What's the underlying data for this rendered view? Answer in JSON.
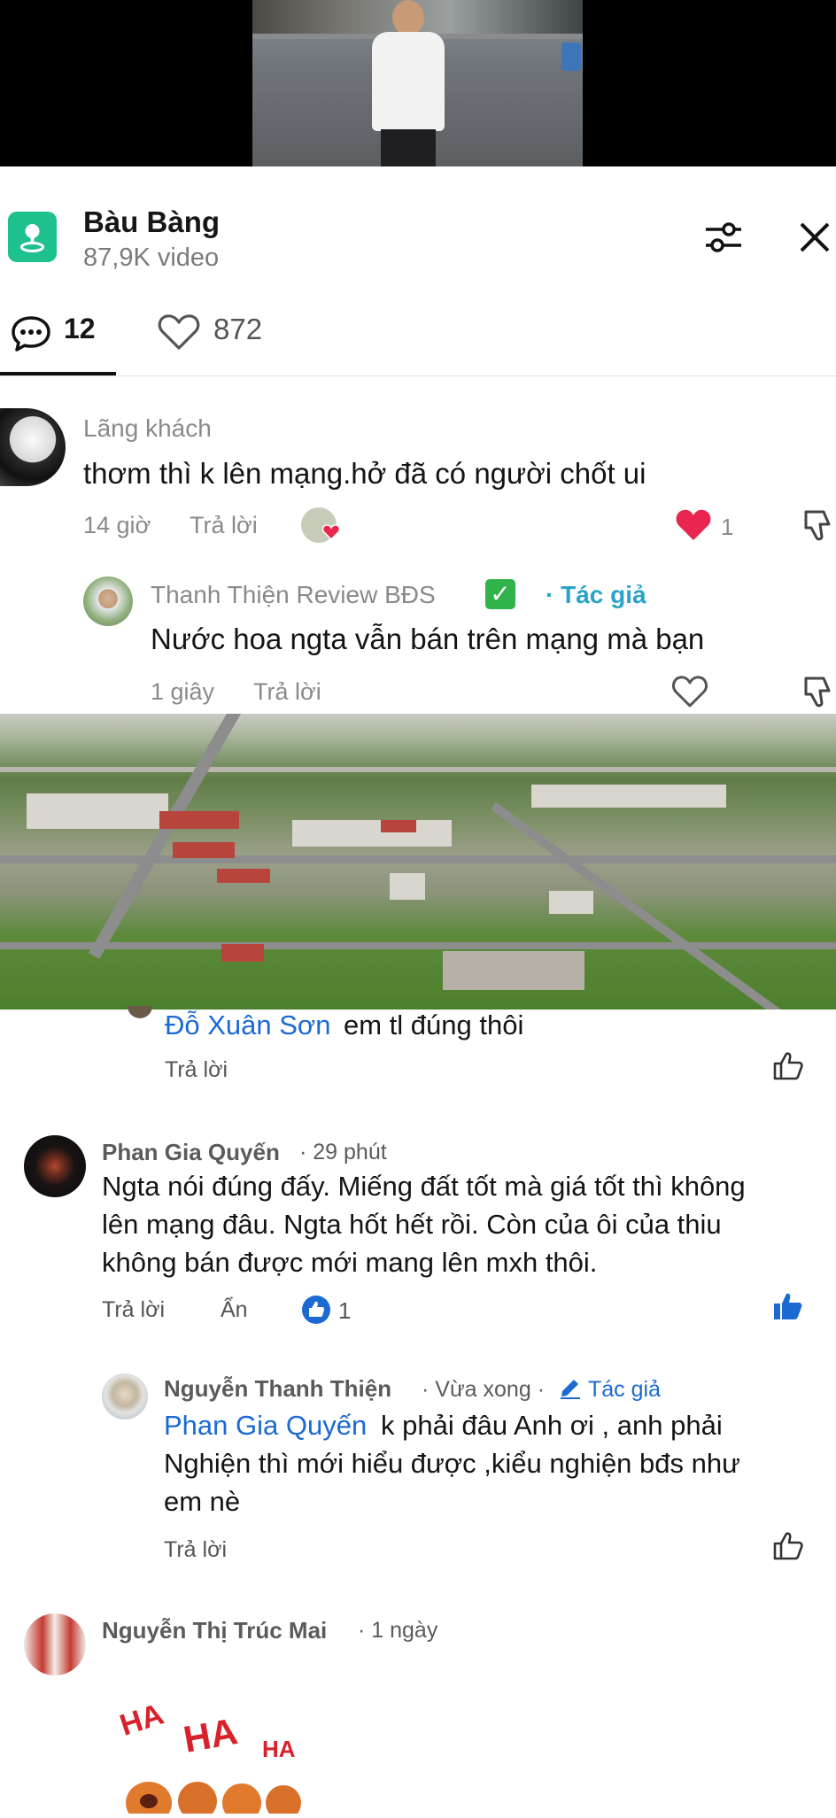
{
  "location": {
    "title": "Bàu Bàng",
    "subtitle": "87,9K video"
  },
  "stats": {
    "comments": "12",
    "likes": "872"
  },
  "tiktok_comments": [
    {
      "author": "Lãng khách",
      "text": "thơm thì k lên mạng.hở đã có người chốt ui",
      "time": "14 giờ",
      "reply": "Trả lời",
      "likes": "1"
    },
    {
      "author": "Thanh Thiện Review BĐS",
      "badge": "· Tác giả",
      "text": "Nước hoa ngta vẫn bán trên mạng mà bạn",
      "time": "1 giây",
      "reply": "Trả lời"
    }
  ],
  "facebook_comments": {
    "c1": {
      "mention": "Đỗ Xuân Sơn",
      "text": "em tl đúng thôi",
      "reply": "Trả lời"
    },
    "c2": {
      "author": "Phan Gia Quyến",
      "time": "· 29 phút",
      "lines": [
        "Ngta nói đúng đấy. Miếng đất tốt mà giá tốt thì không",
        "lên mạng đâu. Ngta hốt hết rồi. Còn của ôi của thiu",
        "không bán được mới mang lên mxh thôi."
      ],
      "reply": "Trả lời",
      "hide": "Ẩn",
      "reactions": "1"
    },
    "c3": {
      "author": "Nguyễn Thanh Thiện",
      "time": "· Vừa xong ·",
      "badge": "Tác giả",
      "mention": "Phan Gia Quyến",
      "lines": [
        "k phải đâu Anh ơi , anh phải",
        "Nghiện thì mới hiểu được ,kiểu nghiện bđs như",
        "em nè"
      ],
      "reply": "Trả lời"
    },
    "c4": {
      "author": "Nguyễn Thị Trúc Mai",
      "time": "· 1 ngày",
      "sticker_text": [
        "HA",
        "HA",
        "HA"
      ]
    }
  },
  "colors": {
    "tiktok_location_green": "#1ec08e",
    "tiktok_heart_red": "#e8264f",
    "fb_blue": "#1b6ad2",
    "author_teal": "#2aa3c8"
  }
}
